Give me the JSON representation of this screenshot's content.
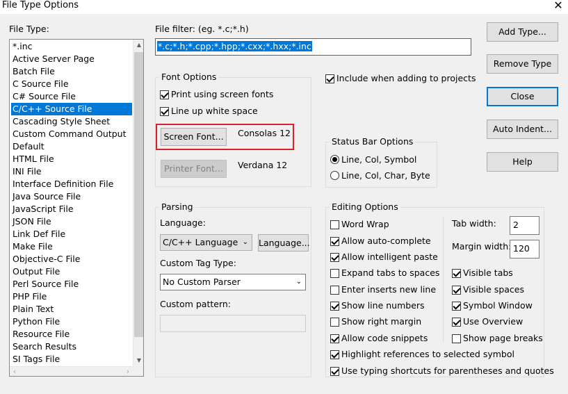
{
  "window": {
    "title": "File Type Options"
  },
  "file_type": {
    "label": "File Type:",
    "items": [
      "*.inc",
      "Active Server Page",
      "Batch File",
      "C Source File",
      "C# Source File",
      "C/C++ Source File",
      "Cascading Style Sheet",
      "Custom Command Output",
      "Default",
      "HTML File",
      "INI File",
      "Interface Definition File",
      "Java Source File",
      "JavaScript File",
      "JSON File",
      "Link Def File",
      "Make File",
      "Objective-C File",
      "Output File",
      "Perl Source File",
      "PHP File",
      "Plain Text",
      "Python File",
      "Resource File",
      "Search Results",
      "SI Tags File"
    ],
    "selected": "C/C++ Source File"
  },
  "file_filter": {
    "label": "File filter: (eg. *.c;*.h)",
    "value": "*.c;*.h;*.cpp;*.hpp;*.cxx;*.hxx;*.inc"
  },
  "include_projects": {
    "label": "Include when adding to projects",
    "checked": true
  },
  "font_options": {
    "title": "Font Options",
    "use_screen_fonts": {
      "label": "Print using screen fonts",
      "checked": true
    },
    "line_up_white_space": {
      "label": "Line up white space",
      "checked": true
    },
    "screen_font_button": "Screen Font...",
    "screen_font_value": "Consolas 12",
    "printer_font_button": "Printer Font...",
    "printer_font_value": "Verdana 12"
  },
  "status_bar": {
    "title": "Status Bar Options",
    "option1": {
      "label": "Line, Col, Symbol",
      "checked": true
    },
    "option2": {
      "label": "Line, Col, Char, Byte",
      "checked": false
    }
  },
  "parsing": {
    "title": "Parsing",
    "language_label": "Language:",
    "language_value": "C/C++ Language",
    "language_button": "Language...",
    "custom_tag_label": "Custom Tag Type:",
    "custom_tag_value": "No Custom Parser",
    "custom_pattern_label": "Custom pattern:",
    "custom_pattern_value": ""
  },
  "editing": {
    "title": "Editing Options",
    "word_wrap": {
      "label": "Word Wrap",
      "checked": false
    },
    "auto_complete": {
      "label": "Allow auto-complete",
      "checked": true
    },
    "intelligent_paste": {
      "label": "Allow intelligent paste",
      "checked": true
    },
    "expand_tabs": {
      "label": "Expand tabs to spaces",
      "checked": false
    },
    "enter_inserts": {
      "label": "Enter inserts new line",
      "checked": false
    },
    "show_line_numbers": {
      "label": "Show line numbers",
      "checked": true
    },
    "show_right_margin": {
      "label": "Show right margin",
      "checked": false
    },
    "code_snippets": {
      "label": "Allow code snippets",
      "checked": true
    },
    "tab_width_label": "Tab width:",
    "tab_width_value": "2",
    "margin_width_label": "Margin width:",
    "margin_width_value": "120",
    "visible_tabs": {
      "label": "Visible tabs",
      "checked": true
    },
    "visible_spaces": {
      "label": "Visible spaces",
      "checked": true
    },
    "symbol_window": {
      "label": "Symbol Window",
      "checked": true
    },
    "use_overview": {
      "label": "Use Overview",
      "checked": true
    },
    "show_page_breaks": {
      "label": "Show page breaks",
      "checked": false
    },
    "highlight_refs": {
      "label": "Highlight references to selected symbol",
      "checked": true
    },
    "typing_shortcuts": {
      "label": "Use typing shortcuts for parentheses and quotes",
      "checked": true
    }
  },
  "buttons": {
    "add_type": "Add Type...",
    "remove_type": "Remove Type",
    "close": "Close",
    "auto_indent": "Auto Indent...",
    "help": "Help"
  },
  "colors": {
    "selection": "#0078d7",
    "highlight_box": "#d9202a"
  }
}
